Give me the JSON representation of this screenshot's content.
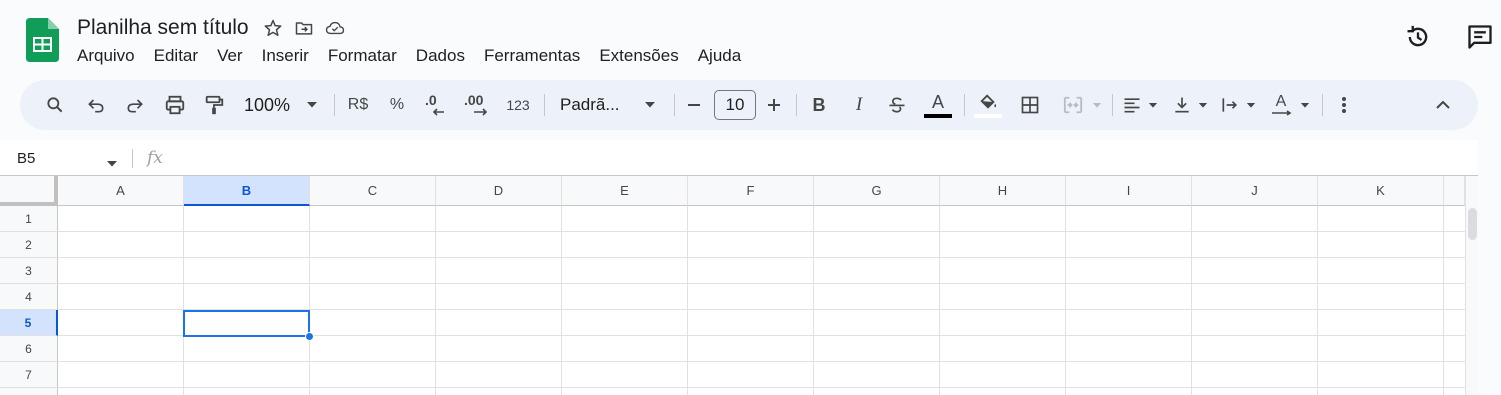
{
  "app": {
    "title": "Planilha sem título"
  },
  "menu": [
    "Arquivo",
    "Editar",
    "Ver",
    "Inserir",
    "Formatar",
    "Dados",
    "Ferramentas",
    "Extensões",
    "Ajuda"
  ],
  "toolbar": {
    "zoom": "100%",
    "currency": "R$",
    "percent": "%",
    "decrease_decimals": ".0",
    "increase_decimals": ".00",
    "number_format": "123",
    "font": "Padrã...",
    "font_size": "10",
    "bold": "B",
    "italic": "I",
    "text_color_letter": "A",
    "text_rotation_letter": "A"
  },
  "formula_bar": {
    "name_box": "B5",
    "fx": "fx"
  },
  "grid": {
    "columns": [
      "A",
      "B",
      "C",
      "D",
      "E",
      "F",
      "G",
      "H",
      "I",
      "J",
      "K"
    ],
    "rows": [
      "1",
      "2",
      "3",
      "4",
      "5",
      "6",
      "7"
    ],
    "selected_column": "B",
    "selected_row": "5"
  },
  "colors": {
    "sheets_green": "#0f9d58",
    "selection_blue": "#1a73e8",
    "header_selected_bg": "#d3e3fd",
    "toolbar_bg": "#edf2fa"
  }
}
